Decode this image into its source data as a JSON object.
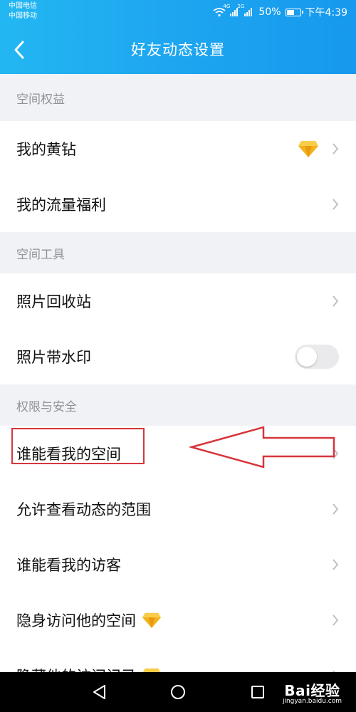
{
  "status_bar": {
    "carrier_1": "中国电信",
    "carrier_2": "中国移动",
    "signal_tag_1": "4G",
    "signal_tag_2": "2G",
    "battery_percent": "50%",
    "time": "下午4:39",
    "icons": [
      "wifi-icon",
      "signal-icon",
      "signal-icon",
      "battery-icon"
    ]
  },
  "header": {
    "title": "好友动态设置",
    "back_icon": "back-arrow-icon",
    "background_color": "#1ea7f0"
  },
  "sections": [
    {
      "title": "空间权益",
      "items": [
        {
          "label": "我的黄钻",
          "icon": "yellow-diamond-icon",
          "control": "chevron"
        },
        {
          "label": "我的流量福利",
          "control": "chevron"
        }
      ]
    },
    {
      "title": "空间工具",
      "items": [
        {
          "label": "照片回收站",
          "control": "chevron"
        },
        {
          "label": "照片带水印",
          "control": "toggle",
          "toggle_on": false
        }
      ]
    },
    {
      "title": "权限与安全",
      "items": [
        {
          "label": "谁能看我的空间",
          "control": "chevron",
          "annotated": true
        },
        {
          "label": "允许查看动态的范围",
          "control": "chevron"
        },
        {
          "label": "谁能看我的访客",
          "control": "chevron"
        },
        {
          "label": "隐身访问他的空间",
          "icon": "yellow-diamond-icon",
          "control": "chevron"
        },
        {
          "label": "隐藏他的访问记录",
          "icon": "yellow-diamond-icon",
          "control": "chevron"
        }
      ]
    }
  ],
  "annotation": {
    "box_color": "#d6363b",
    "arrow_color": "#d6363b"
  },
  "nav_bar": {
    "buttons": [
      "back-triangle-icon",
      "home-circle-icon",
      "recents-square-icon"
    ]
  },
  "watermark": {
    "main": "Bai经验",
    "sub": "jingyan.baidu.com"
  }
}
